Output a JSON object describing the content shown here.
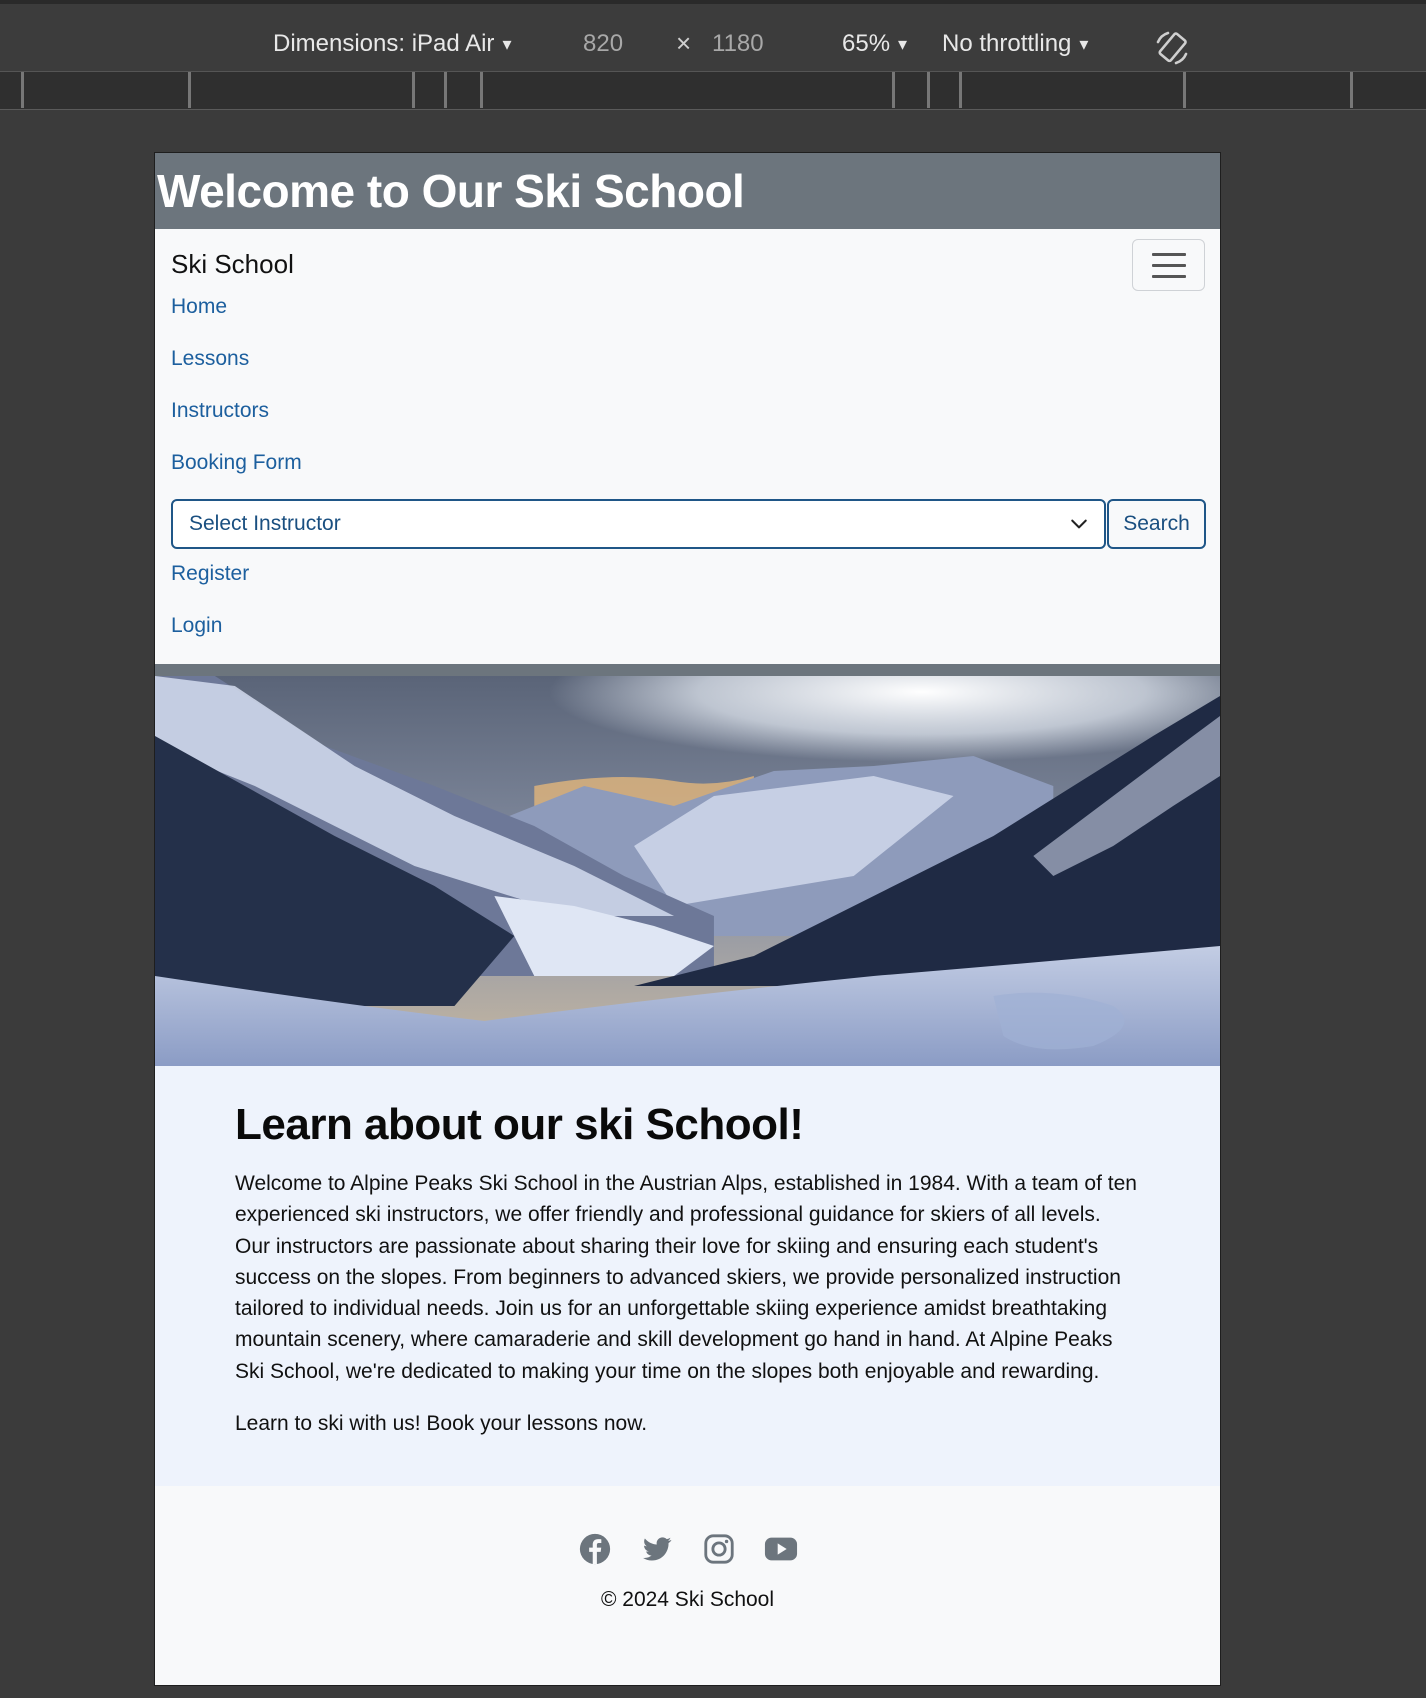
{
  "devtools": {
    "dimensions_label": "Dimensions: iPad Air",
    "width": "820",
    "times": "×",
    "height": "1180",
    "zoom": "65%",
    "throttling": "No throttling",
    "caret": "▾",
    "rotate_icon": "rotate-icon"
  },
  "page": {
    "header_title": "Welcome to Our Ski School",
    "brand": "Ski School",
    "nav": {
      "home": "Home",
      "lessons": "Lessons",
      "instructors": "Instructors",
      "booking": "Booking Form",
      "register": "Register",
      "login": "Login"
    },
    "select_instructor": "Select Instructor",
    "search_button": "Search",
    "hero_image": "snowy alpine valley with pine forest",
    "heading": "Learn about our ski School!",
    "paragraph1": "Welcome to Alpine Peaks Ski School in the Austrian Alps, established in 1984. With a team of ten experienced ski instructors, we offer friendly and professional guidance for skiers of all levels. Our instructors are passionate about sharing their love for skiing and ensuring each student's success on the slopes. From beginners to advanced skiers, we provide personalized instruction tailored to individual needs. Join us for an unforgettable skiing experience amidst breathtaking mountain scenery, where camaraderie and skill development go hand in hand. At Alpine Peaks Ski School, we're dedicated to making your time on the slopes both enjoyable and rewarding.",
    "paragraph2": "Learn to ski with us! Book your lessons now.",
    "social_icons": [
      "facebook-icon",
      "twitter-icon",
      "instagram-icon",
      "youtube-icon"
    ],
    "copyright": "© 2024 Ski School"
  },
  "colors": {
    "header_bg": "#6c757d",
    "link": "#1c5f9e",
    "content_bg": "#eef3fc",
    "icon": "#6c757d"
  }
}
